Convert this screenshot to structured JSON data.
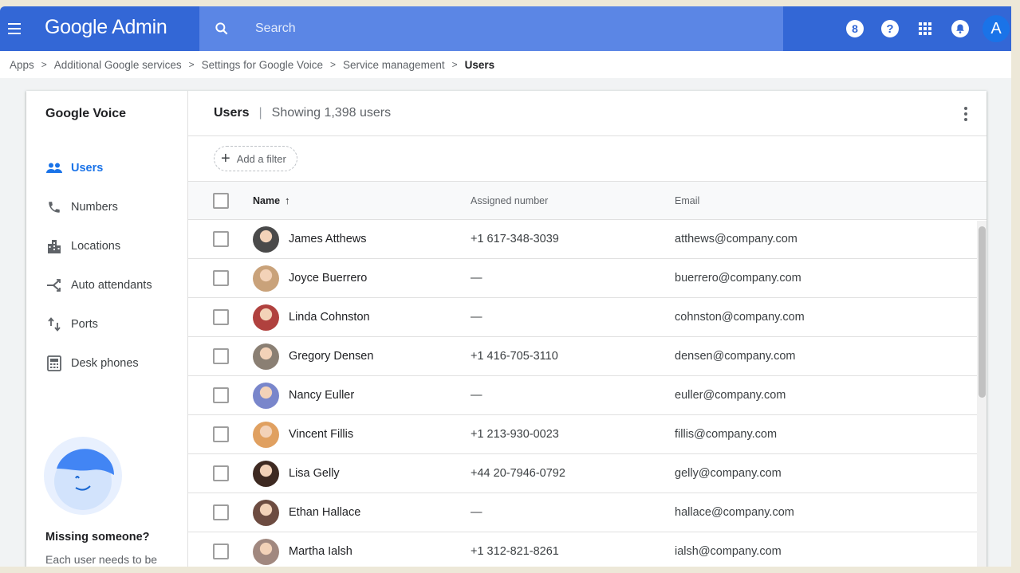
{
  "header": {
    "brand": "Google Admin",
    "search_placeholder": "Search",
    "icons": [
      "menu-icon",
      "search-icon",
      "support-8-icon",
      "help-icon",
      "apps-grid-icon",
      "notifications-bell-icon",
      "account-avatar"
    ],
    "avatar_letter": "A",
    "colors": {
      "bar": "#3367d6",
      "search": "#5b86e5"
    }
  },
  "breadcrumb": {
    "items": [
      "Apps",
      "Additional Google services",
      "Settings for Google Voice",
      "Service management",
      "Users"
    ]
  },
  "sidebar": {
    "title": "Google Voice",
    "items": [
      {
        "label": "Users",
        "icon": "people-icon",
        "active": true
      },
      {
        "label": "Numbers",
        "icon": "phone-icon",
        "active": false
      },
      {
        "label": "Locations",
        "icon": "buildings-icon",
        "active": false
      },
      {
        "label": "Auto attendants",
        "icon": "call-split-icon",
        "active": false
      },
      {
        "label": "Ports",
        "icon": "swap-vert-icon",
        "active": false
      },
      {
        "label": "Desk phones",
        "icon": "desk-phone-icon",
        "active": false
      }
    ],
    "missing_title": "Missing someone?",
    "missing_text": "Each user needs to be"
  },
  "main": {
    "title": "Users",
    "count_text": "Showing 1,398 users",
    "filter_label": "Add a filter",
    "columns": {
      "name": "Name",
      "number": "Assigned number",
      "email": "Email"
    },
    "rows": [
      {
        "name": "James Atthews",
        "number": "+1 617-348-3039",
        "email": "atthews@company.com",
        "avatar_color": "#4a4a4a"
      },
      {
        "name": "Joyce Buerrero",
        "number": "—",
        "email": "buerrero@company.com",
        "avatar_color": "#c9a27a"
      },
      {
        "name": "Linda Cohnston",
        "number": "—",
        "email": "cohnston@company.com",
        "avatar_color": "#b0413e"
      },
      {
        "name": "Gregory Densen",
        "number": "+1 416-705-3110",
        "email": "densen@company.com",
        "avatar_color": "#8a7f73"
      },
      {
        "name": "Nancy Euller",
        "number": "—",
        "email": "euller@company.com",
        "avatar_color": "#7986cb"
      },
      {
        "name": "Vincent Fillis",
        "number": "+1 213-930-0023",
        "email": "fillis@company.com",
        "avatar_color": "#e0a060"
      },
      {
        "name": "Lisa Gelly",
        "number": "+44 20-7946-0792",
        "email": "gelly@company.com",
        "avatar_color": "#3e2a22"
      },
      {
        "name": "Ethan Hallace",
        "number": "—",
        "email": "hallace@company.com",
        "avatar_color": "#6d4c41"
      },
      {
        "name": "Martha Ialsh",
        "number": "+1 312-821-8261",
        "email": "ialsh@company.com",
        "avatar_color": "#a1887f"
      }
    ]
  }
}
